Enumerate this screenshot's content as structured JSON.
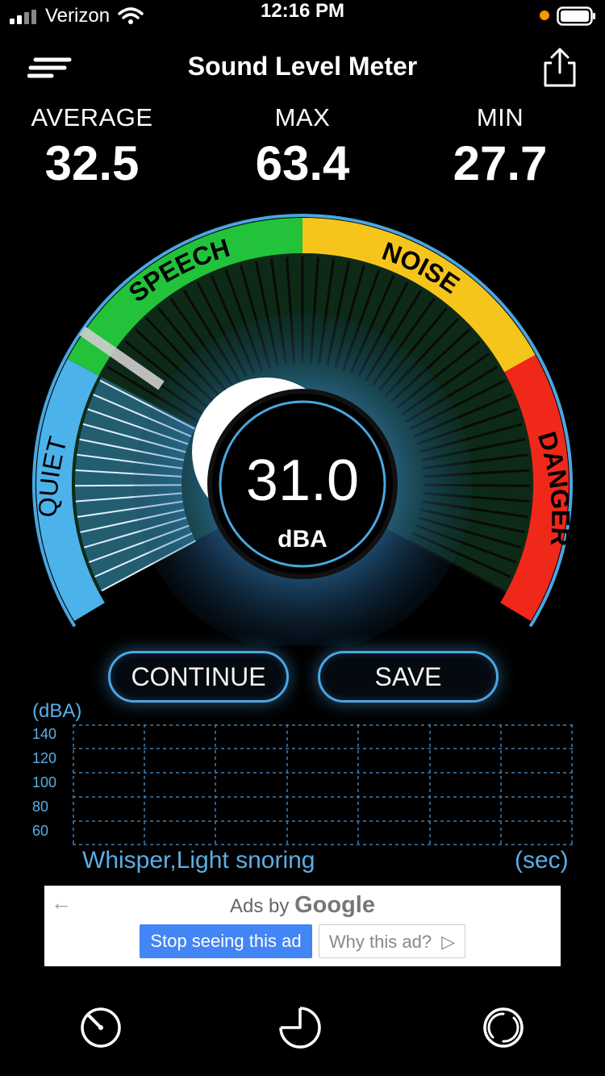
{
  "status_bar": {
    "carrier": "Verizon",
    "time": "12:16 PM"
  },
  "nav": {
    "title": "Sound Level Meter",
    "menu_icon": "hamburger-icon",
    "share_icon": "share-icon"
  },
  "stats": {
    "average": {
      "label": "AVERAGE",
      "value": "32.5"
    },
    "max": {
      "label": "MAX",
      "value": "63.4"
    },
    "min": {
      "label": "MIN",
      "value": "27.7"
    }
  },
  "gauge": {
    "zones": [
      {
        "label": "QUIET",
        "color": "#4cb2ea"
      },
      {
        "label": "SPEECH",
        "color": "#22c23a"
      },
      {
        "label": "NOISE",
        "color": "#f5c51c"
      },
      {
        "label": "DANGER",
        "color": "#f0281a"
      }
    ],
    "reading": "31.0",
    "unit": "dBA"
  },
  "buttons": {
    "continue": "CONTINUE",
    "save": "SAVE"
  },
  "history_chart": {
    "y_unit": "(dBA)",
    "y_ticks": [
      "140",
      "120",
      "100",
      "80",
      "60"
    ],
    "description": "Whisper,Light snoring",
    "x_unit": "(sec)"
  },
  "ad": {
    "back_icon": "left-arrow-icon",
    "prefix": "Ads by",
    "brand": "Google",
    "stop_label": "Stop seeing this ad",
    "why_label": "Why this ad?"
  },
  "tabs": [
    {
      "name": "meter",
      "icon": "gauge-icon"
    },
    {
      "name": "history",
      "icon": "pie-icon"
    },
    {
      "name": "settings",
      "icon": "circle-icon"
    }
  ],
  "colors": {
    "accent": "#4aa6e0",
    "label_blue": "#5aaee6"
  }
}
